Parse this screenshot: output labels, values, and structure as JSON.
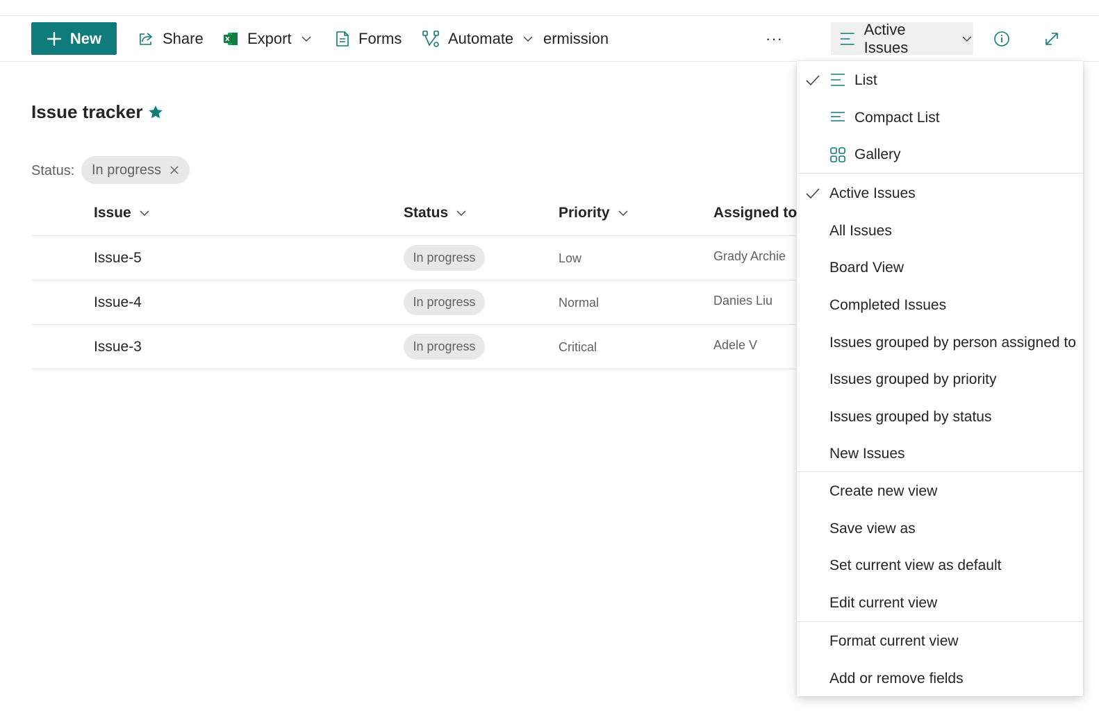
{
  "toolbar": {
    "new_label": "New",
    "share_label": "Share",
    "export_label": "Export",
    "forms_label": "Forms",
    "automate_label": "Automate",
    "permission_label": "ermission",
    "more_label": "···",
    "view_label": "Active Issues"
  },
  "page": {
    "title": "Issue tracker"
  },
  "filter": {
    "label": "Status:",
    "value": "In progress"
  },
  "table": {
    "columns": [
      "Issue",
      "Status",
      "Priority",
      "Assigned to"
    ],
    "rows": [
      {
        "issue": "Issue-5",
        "status": "In progress",
        "priority": "Low",
        "assigned": "Grady Archie"
      },
      {
        "issue": "Issue-4",
        "status": "In progress",
        "priority": "Normal",
        "assigned": "Danies Liu"
      },
      {
        "issue": "Issue-3",
        "status": "In progress",
        "priority": "Critical",
        "assigned": "Adele V"
      }
    ]
  },
  "menu": {
    "layouts": [
      {
        "label": "List",
        "icon": "list-icon",
        "checked": true
      },
      {
        "label": "Compact List",
        "icon": "compact-list-icon",
        "checked": false
      },
      {
        "label": "Gallery",
        "icon": "gallery-icon",
        "checked": false
      }
    ],
    "views": [
      {
        "label": "Active Issues",
        "checked": true
      },
      {
        "label": "All Issues"
      },
      {
        "label": "Board View"
      },
      {
        "label": "Completed Issues"
      },
      {
        "label": "Issues grouped by person assigned to"
      },
      {
        "label": "Issues grouped by priority"
      },
      {
        "label": "Issues grouped by status"
      },
      {
        "label": "New Issues"
      }
    ],
    "actions": [
      {
        "label": "Create new view"
      },
      {
        "label": "Save view as"
      },
      {
        "label": "Set current view as default"
      },
      {
        "label": "Edit current view"
      }
    ],
    "format": [
      {
        "label": "Format current view"
      },
      {
        "label": "Add or remove fields"
      }
    ]
  },
  "colors": {
    "accent": "#0f7b7b",
    "excel_green": "#107c41"
  }
}
